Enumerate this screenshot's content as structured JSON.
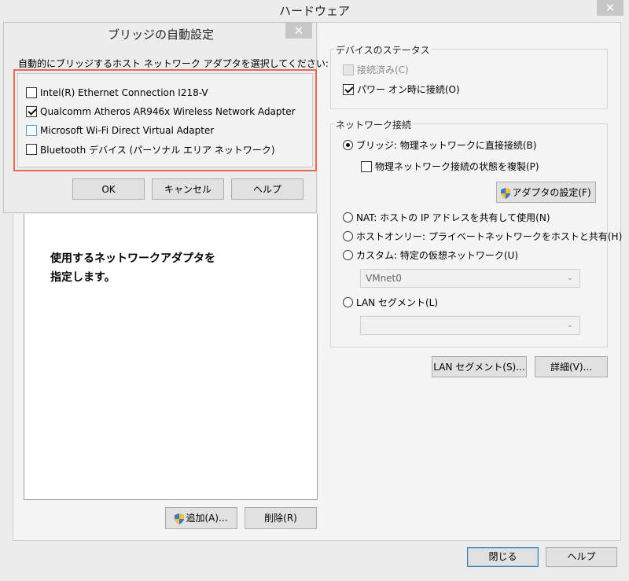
{
  "main_window": {
    "title": "ハードウェア",
    "close_glyph": "✕",
    "description_line1": "使用するネットワークアダプタを",
    "description_line2": "指定します。",
    "add_button": "追加(A)...",
    "remove_button": "削除(R)",
    "close_button": "閉じる",
    "help_button": "ヘルプ"
  },
  "device_status": {
    "title": "デバイスのステータス",
    "connected": {
      "label": "接続済み(C)",
      "checked": false,
      "disabled": true
    },
    "connect_at_power_on": {
      "label": "パワー オン時に接続(O)",
      "checked": true
    }
  },
  "network_connection": {
    "title": "ネットワーク接続",
    "bridged": {
      "label": "ブリッジ: 物理ネットワークに直接接続(B)",
      "selected": true
    },
    "replicate_state": {
      "label": "物理ネットワーク接続の状態を複製(P)",
      "checked": false
    },
    "configure_adapters_button": "アダプタの設定(F)",
    "nat": {
      "label": "NAT: ホストの IP アドレスを共有して使用(N)",
      "selected": false
    },
    "host_only": {
      "label": "ホストオンリー: プライベートネットワークをホストと共有(H)",
      "selected": false
    },
    "custom": {
      "label": "カスタム: 特定の仮想ネットワーク(U)",
      "selected": false
    },
    "custom_select_value": "VMnet0",
    "lan_segment": {
      "label": "LAN セグメント(L)",
      "selected": false
    },
    "lan_segment_select_value": "",
    "lan_segments_button": "LAN セグメント(S)...",
    "advanced_button": "詳細(V)..."
  },
  "bridge_dialog": {
    "title": "ブリッジの自動設定",
    "close_glyph": "✕",
    "instruction": "自動的にブリッジするホスト ネットワーク アダプタを選択してください:",
    "adapters": [
      {
        "label": "Intel(R) Ethernet Connection I218-V",
        "checked": false
      },
      {
        "label": "Qualcomm Atheros AR946x Wireless Network Adapter",
        "checked": true
      },
      {
        "label": "Microsoft Wi-Fi Direct Virtual Adapter",
        "checked": false
      },
      {
        "label": "Bluetooth デバイス (パーソナル エリア ネットワーク)",
        "checked": false
      }
    ],
    "ok_button": "OK",
    "cancel_button": "キャンセル",
    "help_button": "ヘルプ"
  },
  "colors": {
    "highlight_border": "#de6f56",
    "primary_button_border": "#3c7fb1"
  }
}
